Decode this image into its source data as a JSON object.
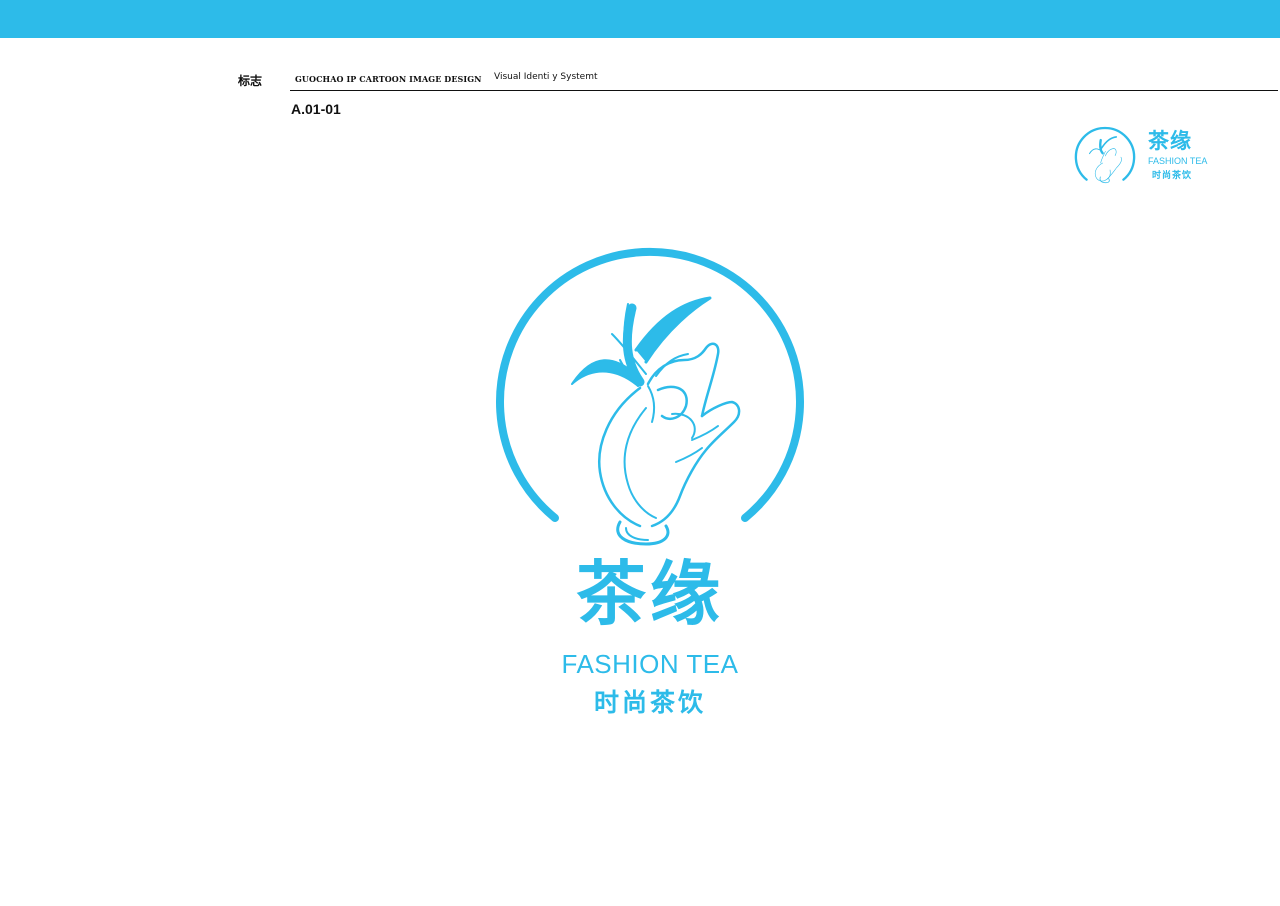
{
  "header": {
    "section_label": "标志",
    "series_title": "GUOCHAO IP CARTOON IMAGE DESIGN",
    "series_subtitle": "Visual Identi y Systemt",
    "page_code": "A.01-01"
  },
  "logo": {
    "title_cn": "茶缘",
    "title_en": "FASHION TEA",
    "tagline_cn": "时尚茶饮",
    "emblem_icon": "hand-holding-tea-leaf-icon",
    "brand_color": "#2dbbe9"
  },
  "colors": {
    "top_band": "#2dbbe9",
    "text_dark": "#111111",
    "background": "#ffffff"
  }
}
